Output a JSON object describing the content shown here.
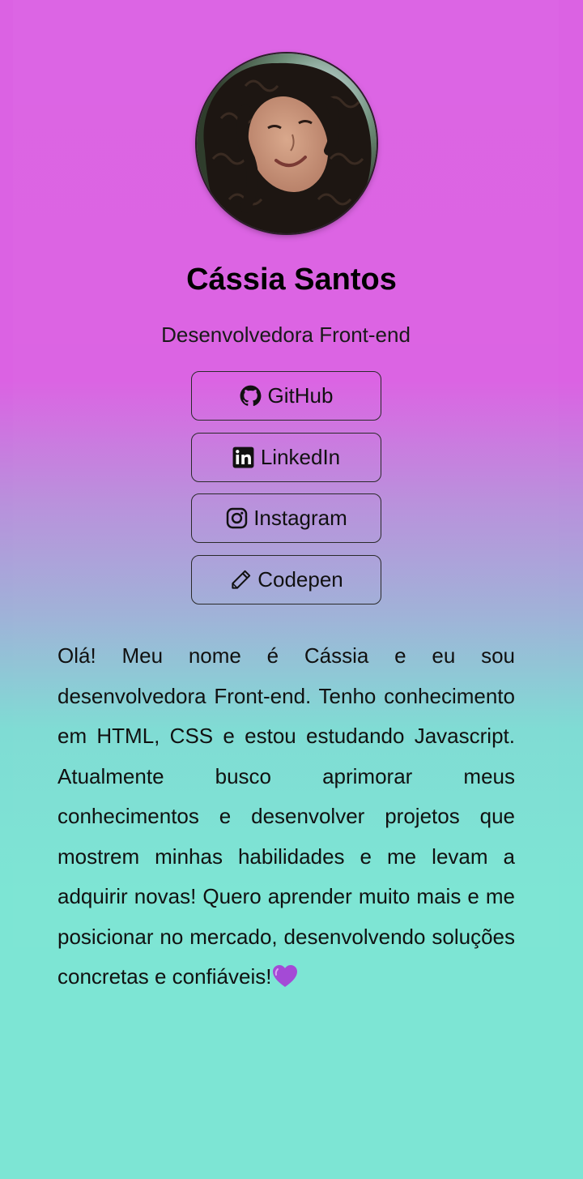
{
  "profile": {
    "name": "Cássia Santos",
    "role": "Desenvolvedora Front-end",
    "avatar_alt": "profile photo"
  },
  "links": [
    {
      "label": "GitHub",
      "icon": "github-icon"
    },
    {
      "label": "LinkedIn",
      "icon": "linkedin-icon"
    },
    {
      "label": "Instagram",
      "icon": "instagram-icon"
    },
    {
      "label": "Codepen",
      "icon": "pencil-icon"
    }
  ],
  "bio": {
    "text": "Olá! Meu nome é Cássia e eu sou desenvolvedora Front-end. Tenho conhecimento em HTML, CSS e estou estudando Javascript. Atualmente busco aprimorar meus conhecimentos e desenvolver projetos que mostrem minhas habilidades e me levam a adquirir novas! Quero aprender muito mais e me posicionar no mercado, desenvolvendo soluções concretas e confiáveis!",
    "emoji": "purple-heart-icon"
  },
  "colors": {
    "gradient_top": "#db62e3",
    "gradient_bottom": "#7de5d4",
    "heart": "#a44ad6"
  }
}
